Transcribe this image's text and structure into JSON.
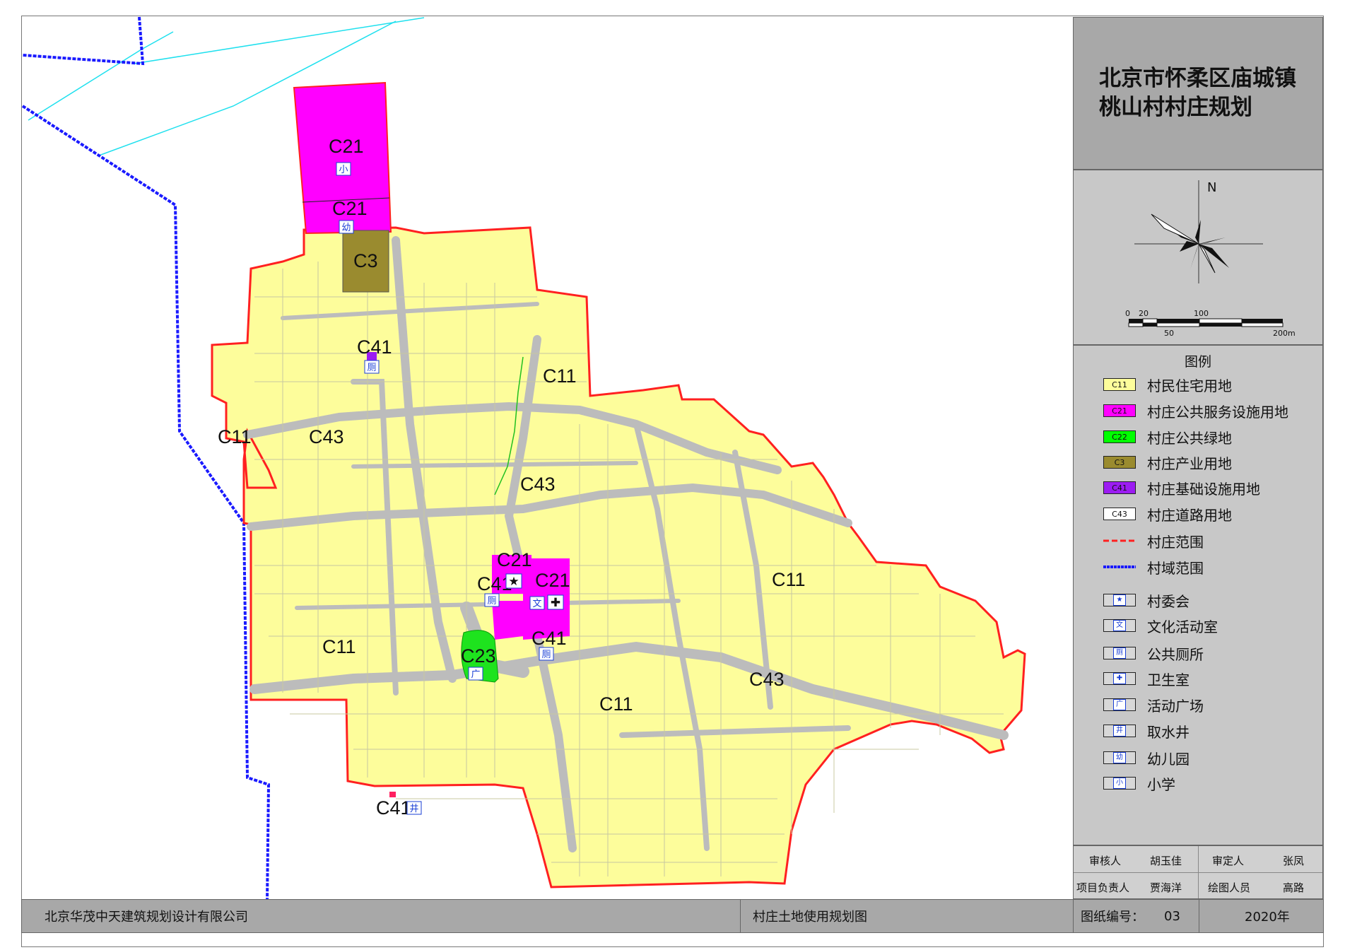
{
  "title": {
    "line1": "北京市怀柔区庙城镇",
    "line2": "桃山村村庄规划"
  },
  "north": {
    "label": "N"
  },
  "scale_bar": {
    "ticks": [
      "0",
      "20",
      "100"
    ],
    "ticks_lower": [
      "50",
      "200m"
    ]
  },
  "legend": {
    "heading": "图例",
    "land_use": [
      {
        "code": "C11",
        "label": "村民住宅用地",
        "color": "#fdfd9b"
      },
      {
        "code": "C21",
        "label": "村庄公共服务设施用地",
        "color": "#ff00ff"
      },
      {
        "code": "C22",
        "label": "村庄公共绿地",
        "color": "#00ff00"
      },
      {
        "code": "C3",
        "label": "村庄产业用地",
        "color": "#9a8b2f"
      },
      {
        "code": "C41",
        "label": "村庄基础设施用地",
        "color": "#9c1cf2"
      },
      {
        "code": "C43",
        "label": "村庄道路用地",
        "color": "#ffffff"
      }
    ],
    "lines": [
      {
        "label": "村庄范围",
        "color": "#ff2020"
      },
      {
        "label": "村域范围",
        "color": "#1a1aff"
      }
    ],
    "symbols": [
      {
        "glyph": "★",
        "label": "村委会",
        "icon": "star-icon"
      },
      {
        "glyph": "文",
        "label": "文化活动室",
        "icon": "culture-icon"
      },
      {
        "glyph": "厕",
        "label": "公共厕所",
        "icon": "toilet-icon"
      },
      {
        "glyph": "✚",
        "label": "卫生室",
        "icon": "clinic-icon"
      },
      {
        "glyph": "广",
        "label": "活动广场",
        "icon": "plaza-icon"
      },
      {
        "glyph": "井",
        "label": "取水井",
        "icon": "well-icon"
      },
      {
        "glyph": "幼",
        "label": "幼儿园",
        "icon": "kindergarten-icon"
      },
      {
        "glyph": "小",
        "label": "小学",
        "icon": "school-icon"
      }
    ]
  },
  "signoff": {
    "reviewer_label": "审核人",
    "reviewer": "胡玉佳",
    "approver_label": "审定人",
    "approver": "张凤",
    "lead_label": "项目负责人",
    "lead": "贾海洋",
    "drafter_label": "绘图人员",
    "drafter": "高路"
  },
  "footer": {
    "company": "北京华茂中天建筑规划设计有限公司",
    "drawing_name": "村庄土地使用规划图",
    "drawing_no_label": "图纸编号：",
    "drawing_no": "03",
    "year": "2020年"
  },
  "map_labels": {
    "c21_school": "C21",
    "school_glyph": "小",
    "c21_kinder": "C21",
    "kinder_glyph": "幼",
    "c3": "C3",
    "c41_north": "C41",
    "toilet_glyph_n": "厕",
    "c11_nw": "C11",
    "c43_w": "C43",
    "c11_n": "C11",
    "c43_c": "C43",
    "c21_cw": "C21",
    "star_glyph": "★",
    "c21_ce": "C21",
    "culture_glyph": "文",
    "clinic_glyph": "✚",
    "c41_cw": "C41",
    "toilet_glyph_c": "厕",
    "c41_ce": "C41",
    "toilet_glyph_e": "厕",
    "c23": "C23",
    "plaza_glyph": "广",
    "c11_e": "C11",
    "c11_sw": "C11",
    "c11_s": "C11",
    "c43_e": "C43",
    "c41_well": "C41",
    "well_glyph": "井"
  }
}
